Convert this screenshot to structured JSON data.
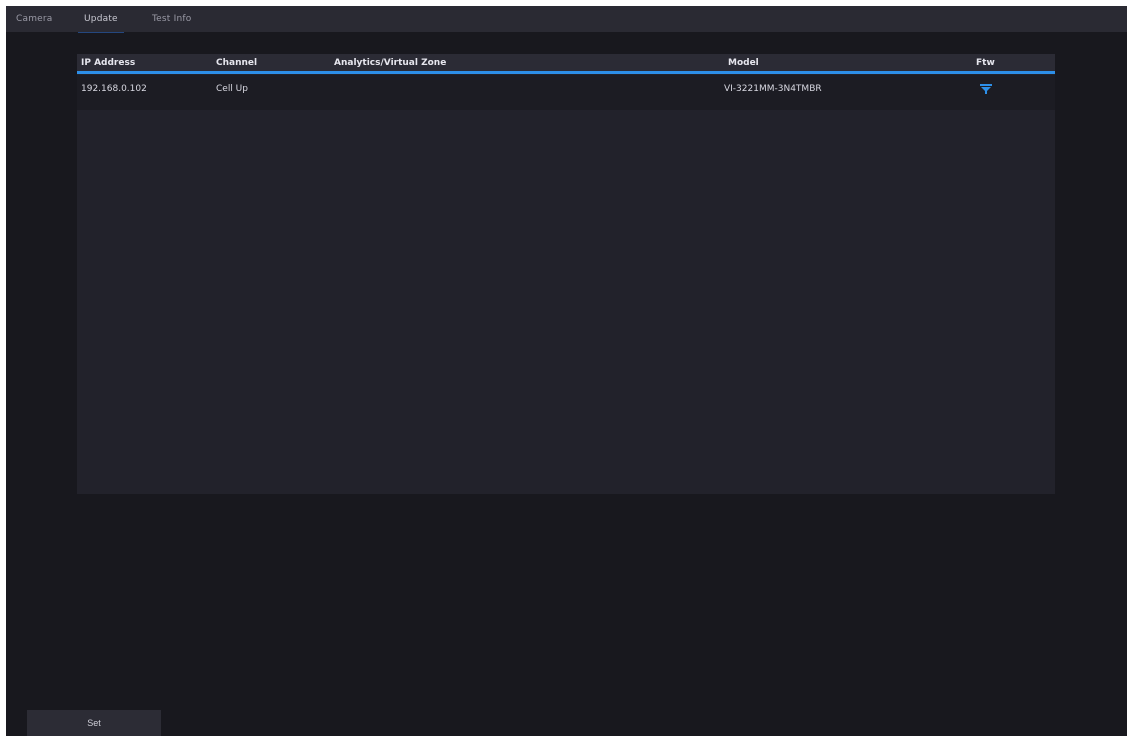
{
  "tabs": [
    {
      "label": "Camera"
    },
    {
      "label": "Update"
    },
    {
      "label": "Test Info"
    }
  ],
  "table": {
    "headers": [
      "IP Address",
      "Channel",
      "Analytics/Virtual Zone",
      "Model",
      "Ftw"
    ],
    "rows": [
      {
        "ip": "192.168.0.102",
        "channel": "Cell Up",
        "analytics": "",
        "model": "VI-3221MM-3N4TMBR",
        "action_icon": "filter-icon"
      }
    ]
  },
  "footer": {
    "button_label": "Set"
  },
  "colors": {
    "accent": "#2d8fe8",
    "background": "#18181e",
    "panel": "#22222b"
  }
}
